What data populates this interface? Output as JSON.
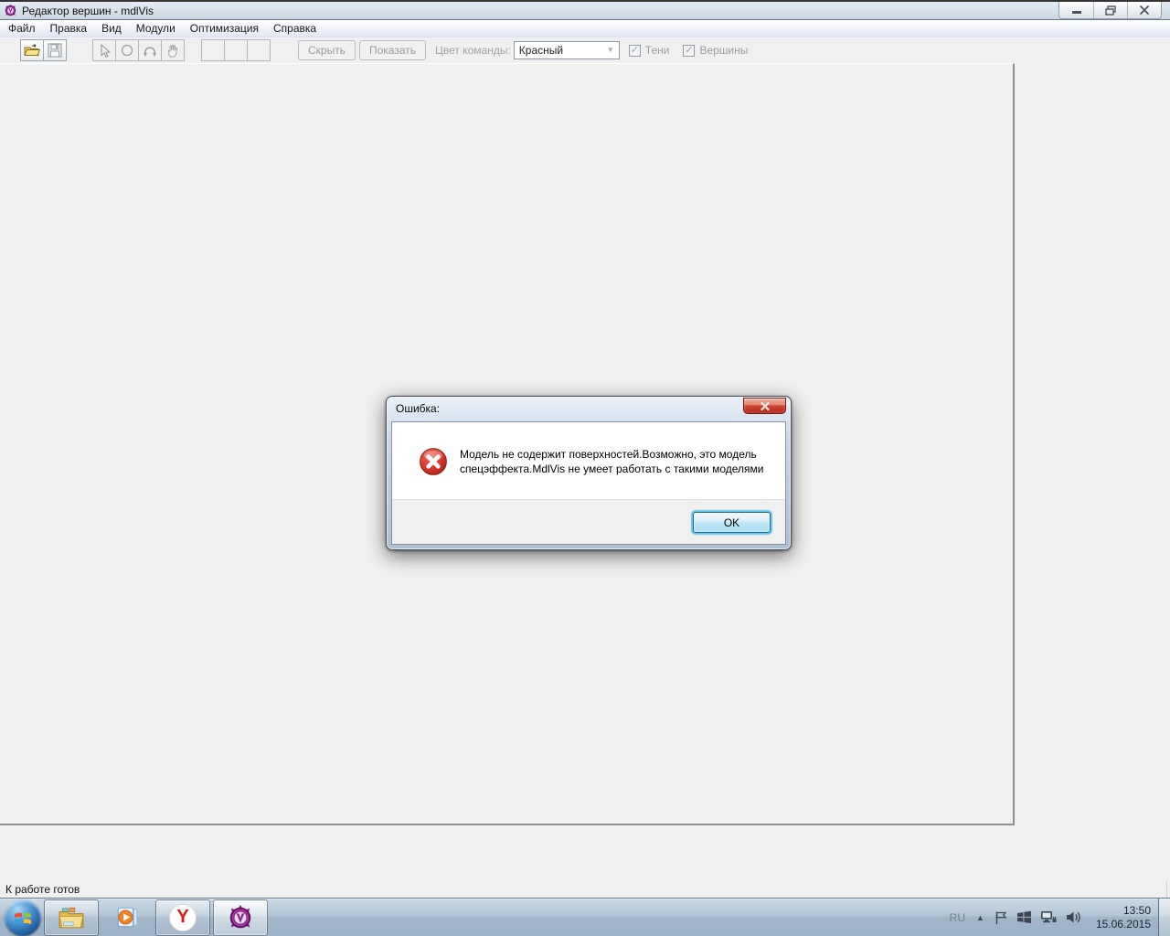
{
  "window": {
    "title": "Редактор вершин - mdlVis"
  },
  "menu": {
    "items": [
      {
        "label": "Файл"
      },
      {
        "label": "Правка"
      },
      {
        "label": "Вид"
      },
      {
        "label": "Модули"
      },
      {
        "label": "Оптимизация"
      },
      {
        "label": "Справка"
      }
    ]
  },
  "toolbar": {
    "hide_label": "Скрыть",
    "show_label": "Показать",
    "team_color": {
      "label": "Цвет команды:",
      "value": "Красный",
      "arrow_glyph": "▼"
    },
    "check_glyph": "✓",
    "checkboxes": [
      {
        "label": "Тени",
        "checked": true
      },
      {
        "label": "Вершины",
        "checked": true
      }
    ]
  },
  "dialog": {
    "title": "Ошибка:",
    "message": "Модель не содержит поверхностей.Возможно, это модель спецэффекта.MdlVis не умеет работать с такими моделями",
    "ok_label": "OK"
  },
  "statusbar": {
    "text": "К работе готов"
  },
  "taskbar": {
    "tray": {
      "language": "RU",
      "hidden_icons_glyph": "▲",
      "time": "13:50",
      "date": "15.06.2015"
    }
  },
  "colors": {
    "titlebar_bg": "#d5dee8",
    "menubar_bg": "#f2f5fb",
    "workspace_bg": "#f0f0f0",
    "taskbar_bg": "#a9bdcf",
    "dialog_frame": "#bccde0",
    "dialog_close_red": "#c2331f",
    "error_icon_red": "#cc2418",
    "ok_focus_glow": "#48bfea",
    "app_accent_purple": "#a935a9"
  }
}
